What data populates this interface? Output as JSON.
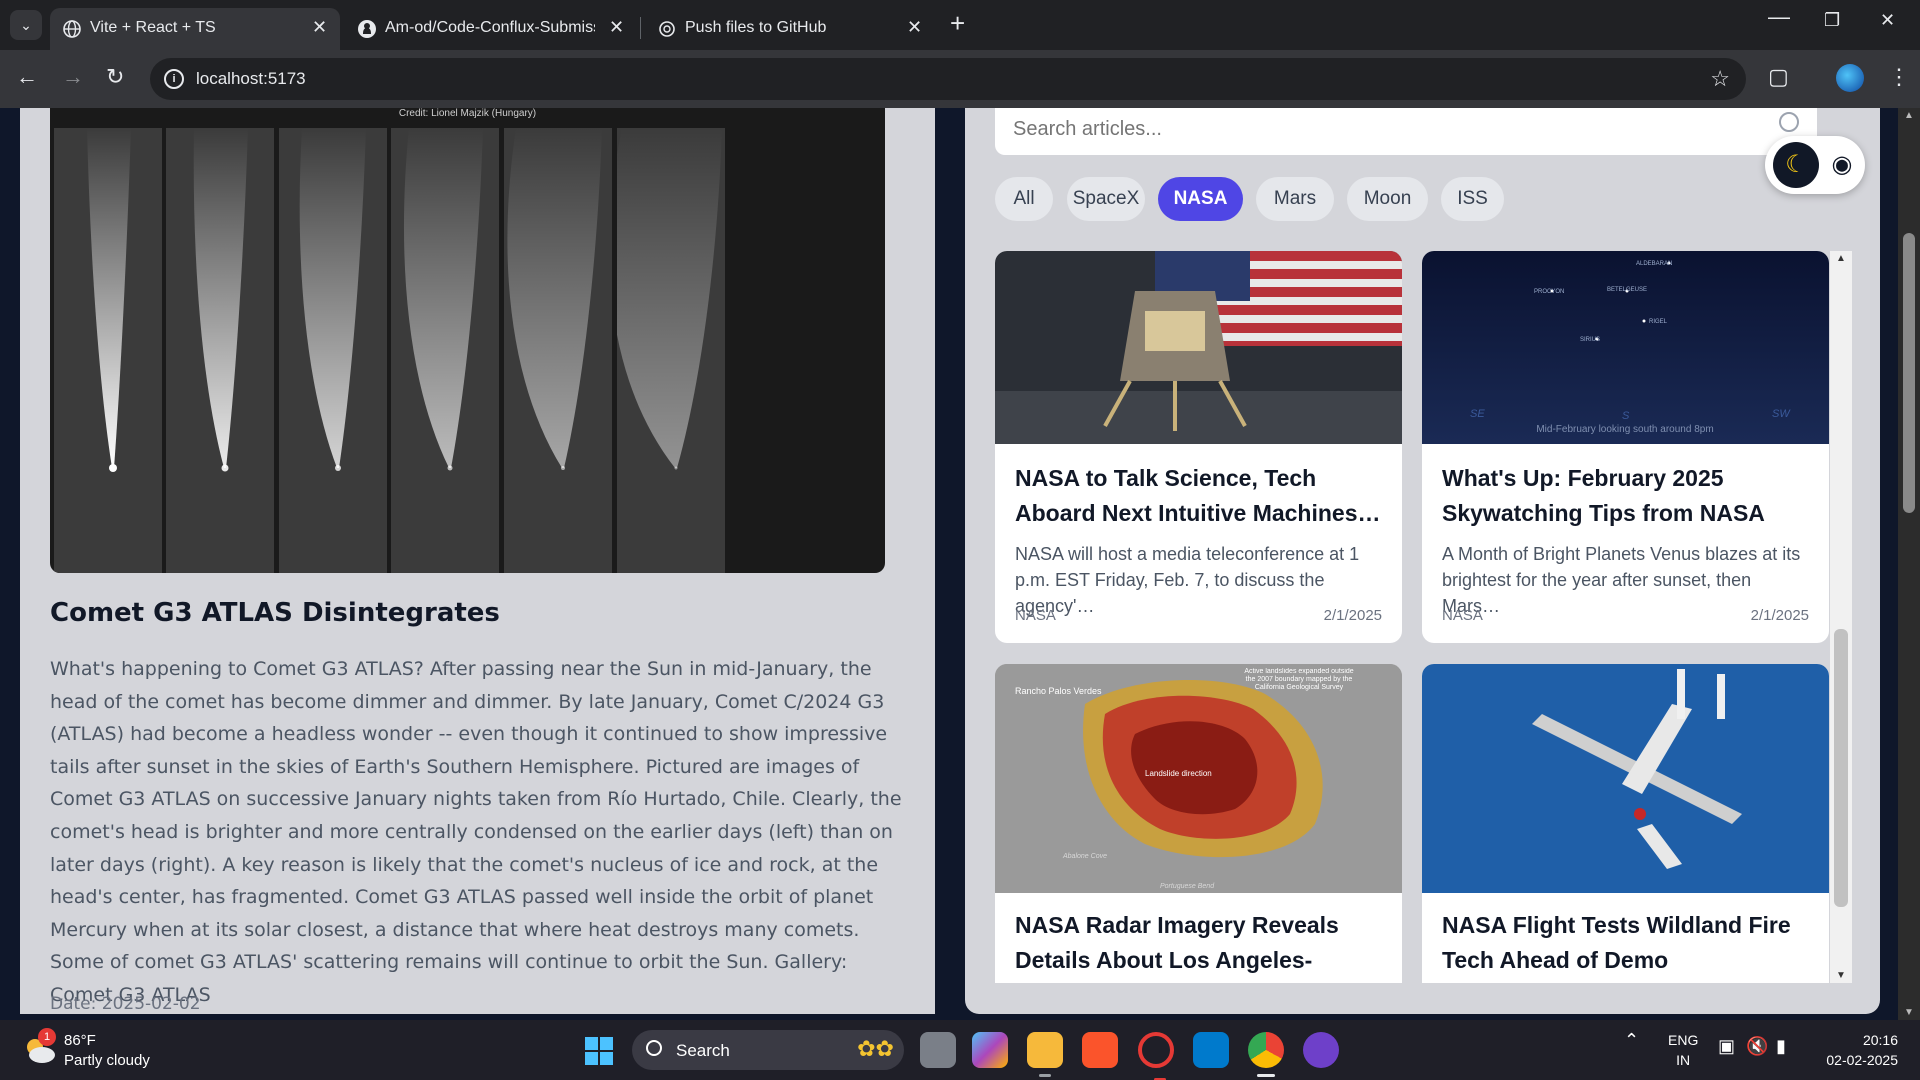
{
  "browser": {
    "tabs": [
      {
        "title": "Vite + React + TS",
        "active": true
      },
      {
        "title": "Am-od/Code-Conflux-Submissi",
        "active": false
      },
      {
        "title": "Push files to GitHub",
        "active": false
      }
    ],
    "url": "localhost:5173"
  },
  "apod": {
    "credit": "Credit: Lionel Majzik (Hungary)",
    "title": "Comet G3 ATLAS Disintegrates",
    "description": "What's happening to Comet G3 ATLAS? After passing near the Sun in mid-January, the head of the comet has become dimmer and dimmer. By late January, Comet C/2024 G3 (ATLAS) had become a headless wonder -- even though it continued to show impressive tails after sunset in the skies of Earth's Southern Hemisphere. Pictured are images of Comet G3 ATLAS on successive January nights taken from Río Hurtado, Chile. Clearly, the comet's head is brighter and more centrally condensed on the earlier days (left) than on later days (right). A key reason is likely that the comet's nucleus of ice and rock, at the head's center, has fragmented. Comet G3 ATLAS passed well inside the orbit of planet Mercury when at its solar closest, a distance that where heat destroys many comets. Some of comet G3 ATLAS' scattering remains will continue to orbit the Sun. Gallery: Comet G3 ATLAS",
    "date": "Date: 2025-02-02"
  },
  "news": {
    "search_placeholder": "Search articles...",
    "filters": [
      "All",
      "SpaceX",
      "NASA",
      "Mars",
      "Moon",
      "ISS"
    ],
    "active_filter": "NASA",
    "articles": [
      {
        "title": "NASA to Talk Science, Tech Aboard Next Intuitive Machines…",
        "description": "NASA will host a media teleconference at 1 p.m. EST Friday, Feb. 7, to discuss the agency'…",
        "source": "NASA",
        "date": "2/1/2025",
        "image": "lunar-lander-flag"
      },
      {
        "title": "What's Up: February 2025 Skywatching Tips from NASA",
        "description": "A Month of Bright Planets Venus blazes at its brightest for the year after sunset, then Mars…",
        "source": "NASA",
        "date": "2/1/2025",
        "image": "night-sky-chart",
        "image_caption": "Mid-February looking south around 8pm",
        "star_labels": [
          "ALDEBARAN",
          "PROCYON",
          "BETELGEUSE",
          "RIGEL",
          "SIRIUS"
        ],
        "compass": [
          "SE",
          "S",
          "SW"
        ]
      },
      {
        "title": "NASA Radar Imagery Reveals Details About Los Angeles-Area…",
        "description": "",
        "source": "",
        "date": "",
        "image": "landslide-radar-map",
        "map_labels": [
          "Rancho Palos Verdes",
          "Active landslides expanded outside the 2007 boundary mapped by the California Geological Survey",
          "Landslide direction",
          "Abalone Cove",
          "Portuguese Bend"
        ]
      },
      {
        "title": "NASA Flight Tests Wildland Fire Tech Ahead of Demo",
        "description": "",
        "source": "",
        "date": "",
        "image": "aircraft-over-ocean"
      }
    ]
  },
  "taskbar": {
    "weather_temp": "86°F",
    "weather_cond": "Partly cloudy",
    "weather_badge": "1",
    "search_label": "Search",
    "lang_line1": "ENG",
    "lang_line2": "IN",
    "time": "20:16",
    "date": "02-02-2025"
  },
  "colors": {
    "accent": "#4f46e5",
    "panel_bg": "#d4d5da",
    "page_bg": "#0f172a"
  }
}
